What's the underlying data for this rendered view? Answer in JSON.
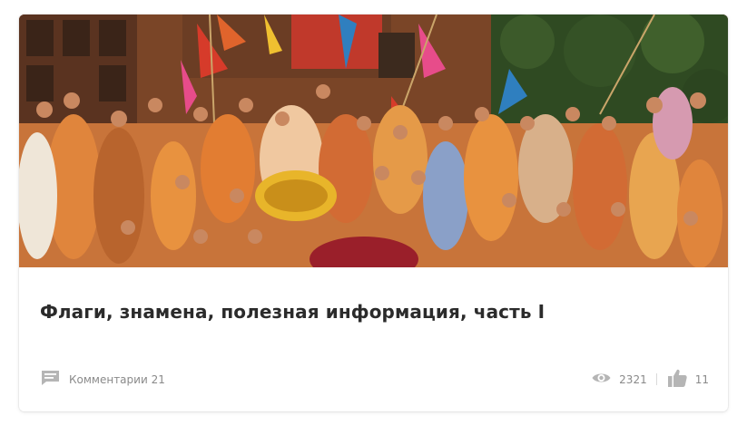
{
  "article": {
    "image_alt": "Crowd of devotees with flags and banners",
    "title": "Флаги, знамена, полезная информация, часть I"
  },
  "meta": {
    "comments_label": "Комментарии 21",
    "views": "2321",
    "likes": "11"
  },
  "icons": {
    "comments": "comment-icon",
    "views": "eye-icon",
    "likes": "thumbs-up-icon"
  },
  "colors": {
    "title": "#2b2b2b",
    "meta_text": "#8a8a8a",
    "icon": "#b5b5b5"
  }
}
